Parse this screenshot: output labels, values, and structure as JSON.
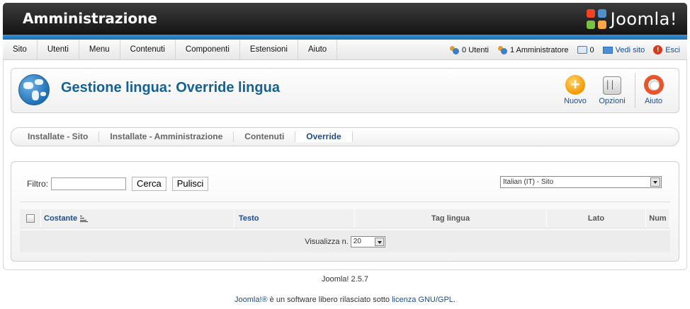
{
  "header": {
    "title": "Amministrazione",
    "logo_text": "Joomla!"
  },
  "menu": {
    "items": [
      "Sito",
      "Utenti",
      "Menu",
      "Contenuti",
      "Componenti",
      "Estensioni",
      "Aiuto"
    ]
  },
  "status": {
    "users": "0 Utenti",
    "admins": "1 Amministratore",
    "messages": "0",
    "view_site": "Vedi sito",
    "logout": "Esci"
  },
  "toolbar": {
    "page_title": "Gestione lingua: Override lingua",
    "new_label": "Nuovo",
    "options_label": "Opzioni",
    "options_glyph": "▏▏",
    "help_label": "Aiuto"
  },
  "submenu": {
    "tabs": [
      "Installate - Sito",
      "Installate - Amministrazione",
      "Contenuti",
      "Override"
    ],
    "active": "Override"
  },
  "filter": {
    "label": "Filtro:",
    "value": "",
    "search_button": "Cerca",
    "clear_button": "Pulisci",
    "language_selected": "Italian (IT) - Sito"
  },
  "table": {
    "columns": {
      "constant": "Costante",
      "text": "Testo",
      "language_tag": "Tag lingua",
      "side": "Lato",
      "num": "Num"
    },
    "footer_label": "Visualizza n.",
    "limit_value": "20"
  },
  "footer": {
    "version": "Joomla! 2.5.7",
    "brand_link": "Joomla!®",
    "text": " è un software libero rilasciato sotto ",
    "license_link": "licenza GNU/GPL",
    "end": "."
  },
  "colors": {
    "accent_blue": "#146295",
    "header_dark": "#0e0e0e",
    "header_blue_strip": "#1f6fb2"
  }
}
